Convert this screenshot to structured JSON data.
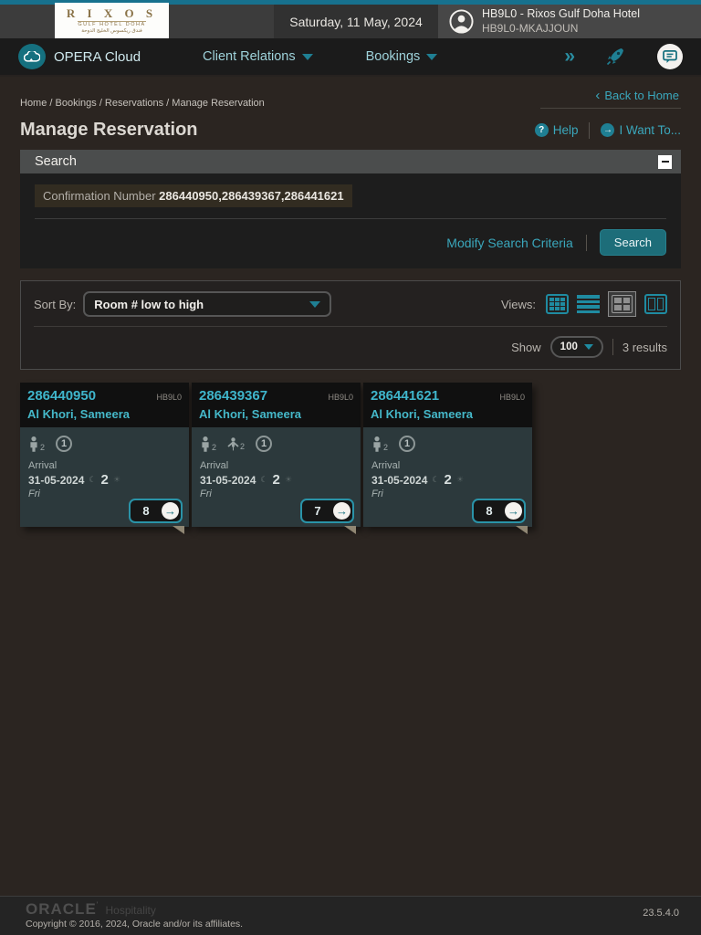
{
  "top_bar": {
    "logo": {
      "brand": "R I X O S",
      "subtitle": "GULF HOTEL DOHA",
      "arabic": "فندق ريكسوس الخليج الدوحة"
    },
    "date": "Saturday, 11 May, 2024",
    "user": {
      "line1": "HB9L0 - Rixos Gulf Doha Hotel",
      "line2": "HB9L0-MKAJJOUN"
    }
  },
  "nav": {
    "app_name": "OPERA Cloud",
    "menus": {
      "client_relations": "Client Relations",
      "bookings": "Bookings"
    },
    "overflow_glyph": "»"
  },
  "breadcrumb": {
    "path": "Home / Bookings / Reservations / Manage Reservation",
    "back_label": "Back to Home",
    "back_chevron": "‹"
  },
  "page": {
    "title": "Manage Reservation",
    "help_label": "Help",
    "help_glyph": "?",
    "i_want_to_label": "I Want To...",
    "i_want_to_glyph": "→"
  },
  "search": {
    "header": "Search",
    "field_label": "Confirmation Number",
    "field_value": "286440950,286439367,286441621",
    "modify_link": "Modify Search Criteria",
    "search_button": "Search"
  },
  "toolbar": {
    "sort_label": "Sort By:",
    "sort_value": "Room # low to high",
    "views_label": "Views:",
    "show_label": "Show",
    "show_value": "100",
    "results": "3 results"
  },
  "cards": [
    {
      "confirmation": "286440950",
      "property": "HB9L0",
      "guest": "Al Khori, Sameera",
      "adults": "2",
      "children": null,
      "linked": "1",
      "arrival_label": "Arrival",
      "arrival_date": "31-05-2024",
      "nights": "2",
      "day": "Fri",
      "room": "8"
    },
    {
      "confirmation": "286439367",
      "property": "HB9L0",
      "guest": "Al Khori, Sameera",
      "adults": "2",
      "children": "2",
      "linked": "1",
      "arrival_label": "Arrival",
      "arrival_date": "31-05-2024",
      "nights": "2",
      "day": "Fri",
      "room": "7"
    },
    {
      "confirmation": "286441621",
      "property": "HB9L0",
      "guest": "Al Khori, Sameera",
      "adults": "2",
      "children": null,
      "linked": "1",
      "arrival_label": "Arrival",
      "arrival_date": "31-05-2024",
      "nights": "2",
      "day": "Fri",
      "room": "8"
    }
  ],
  "glyphs": {
    "moon": "☾",
    "sun": "☀",
    "go_arrow": "→"
  },
  "footer": {
    "oracle": "ORACLE",
    "suffix": "Hospitality",
    "copyright": "Copyright © 2016, 2024, Oracle and/or its affiliates.",
    "version": "23.5.4.0"
  },
  "colors": {
    "accent_link": "#3aa7bc",
    "accent_icon": "#1f7f93",
    "button_bg": "#1d6d79",
    "top_strip": "#17718e"
  }
}
